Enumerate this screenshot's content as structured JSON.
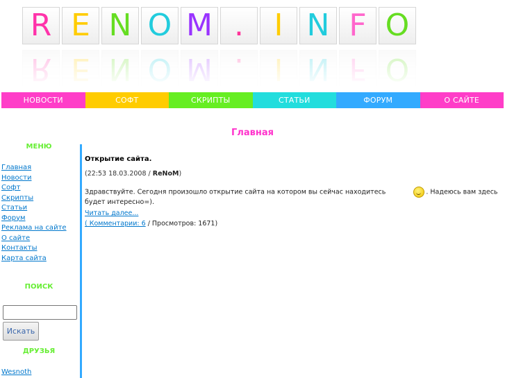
{
  "logo": {
    "letters": [
      "R",
      "E",
      "N",
      "O",
      "M",
      ".",
      "I",
      "N",
      "F",
      "O"
    ],
    "colors": [
      "#ff33aa",
      "#ffcc00",
      "#66dd22",
      "#22ccdd",
      "#9933ff",
      "#ff3399",
      "#ffcc00",
      "#22ccdd",
      "#ff66cc",
      "#66dd22"
    ]
  },
  "nav": {
    "items": [
      {
        "label": "НОВОСТИ",
        "color": "#ff3dc8"
      },
      {
        "label": "СОФТ",
        "color": "#ffcc00"
      },
      {
        "label": "СКРИПТЫ",
        "color": "#66ee22"
      },
      {
        "label": "СТАТЬИ",
        "color": "#22dddd"
      },
      {
        "label": "ФОРУМ",
        "color": "#33aaff"
      },
      {
        "label": "О САЙТЕ",
        "color": "#ff3dc8"
      }
    ]
  },
  "page_title": "Главная",
  "sidebar": {
    "menu_heading": "МЕНЮ",
    "menu_items": [
      "Главная",
      "Новости",
      "Софт",
      "Скрипты",
      "Статьи",
      "Форум",
      "Реклама на сайте",
      "О сайте",
      "Контакты",
      "Карта сайта"
    ],
    "search_heading": "ПОИСК",
    "search_value": "",
    "search_button": "Искать",
    "friends_heading": "ДРУЗЬЯ",
    "friends": [
      "Wesnoth"
    ]
  },
  "post": {
    "title": "Открытие сайта.",
    "date": "(22:53 18.03.2008 / ",
    "author": "ReNoM",
    "date_close": ")",
    "text_before": "Здравствуйте. Сегодня произошло открытие сайта на котором вы сейчас находитесь",
    "text_after": ". Надеюсь вам здесь будет интересно=).",
    "read_more": "Читать далее...",
    "comments_link": "( Комментарии: 6",
    "views": " / Просмотров: 1671)"
  }
}
